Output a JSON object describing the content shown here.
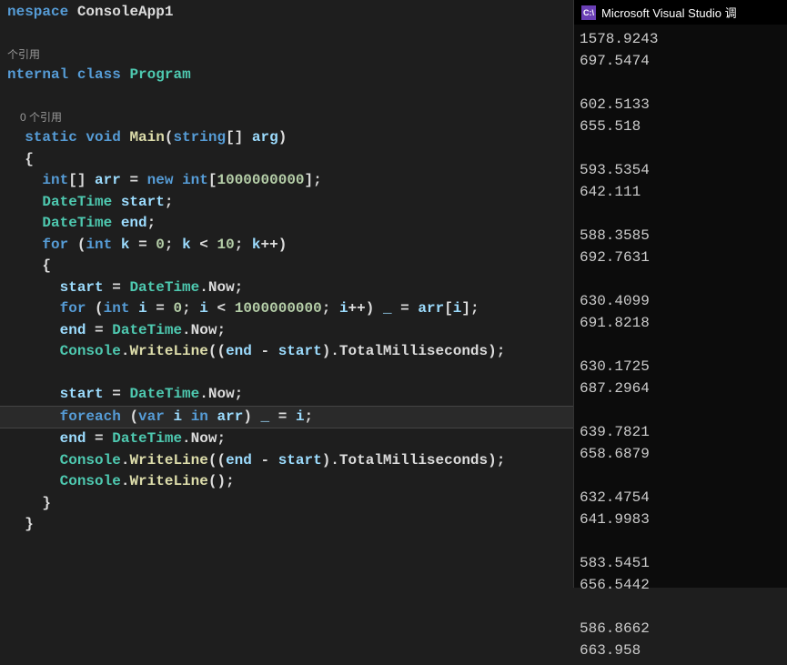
{
  "editor": {
    "namespace_kw": "nespace",
    "namespace_name": "ConsoleApp1",
    "codelens_1": " 个引用",
    "internal_kw": "nternal",
    "class_kw": "class",
    "class_name": "Program",
    "codelens_2": "0 个引用",
    "static_kw": "static",
    "void_kw": "void",
    "main_method": "Main",
    "string_type": "string",
    "arg_name": "arg",
    "int_type": "int",
    "arr_var": "arr",
    "new_kw": "new",
    "arr_size": "1000000000",
    "datetime_type": "DateTime",
    "start_var": "start",
    "end_var": "end",
    "for_kw": "for",
    "k_var": "k",
    "zero": "0",
    "ten": "10",
    "now_prop": "Now",
    "i_var": "i",
    "billion": "1000000000",
    "underscore": "_",
    "console_cls": "Console",
    "writeline_method": "WriteLine",
    "totalms_prop": "TotalMilliseconds",
    "foreach_kw": "foreach",
    "var_kw": "var",
    "in_kw": "in"
  },
  "output": {
    "title": "Microsoft Visual Studio 调",
    "icon_text": "C:\\",
    "lines": [
      "1578.9243",
      "697.5474",
      "",
      "602.5133",
      "655.518",
      "",
      "593.5354",
      "642.111",
      "",
      "588.3585",
      "692.7631",
      "",
      "630.4099",
      "691.8218",
      "",
      "630.1725",
      "687.2964",
      "",
      "639.7821",
      "658.6879",
      "",
      "632.4754",
      "641.9983",
      "",
      "583.5451",
      "656.5442",
      "",
      "586.8662",
      "663.958"
    ]
  }
}
